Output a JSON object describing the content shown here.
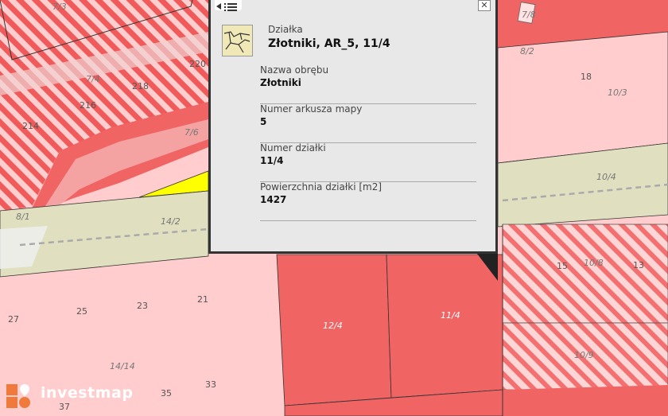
{
  "map": {
    "parcel_labels": [
      {
        "text": "7/3"
      },
      {
        "text": "7/4"
      },
      {
        "text": "218"
      },
      {
        "text": "220"
      },
      {
        "text": "216"
      },
      {
        "text": "214"
      },
      {
        "text": "7/6"
      },
      {
        "text": "8/1"
      },
      {
        "text": "14/2"
      },
      {
        "text": "7/8"
      },
      {
        "text": "8/2"
      },
      {
        "text": "18"
      },
      {
        "text": "10/3"
      },
      {
        "text": "10/4"
      },
      {
        "text": "15"
      },
      {
        "text": "10/8"
      },
      {
        "text": "13"
      },
      {
        "text": "10/9"
      },
      {
        "text": "27"
      },
      {
        "text": "25"
      },
      {
        "text": "23"
      },
      {
        "text": "21"
      },
      {
        "text": "14/14"
      },
      {
        "text": "33"
      },
      {
        "text": "35"
      },
      {
        "text": "37"
      },
      {
        "text": "12/4"
      },
      {
        "text": "11/4"
      }
    ],
    "colors": {
      "residential": "#ffcccc",
      "selected": "#ff6b6b",
      "agri": "#e0e0c0",
      "road": "#f8f8f8",
      "yellow": "#ffff00",
      "hatch": "#f06060"
    }
  },
  "popup": {
    "category": "Działka",
    "title": "Złotniki, AR_5, 11/4",
    "fields": [
      {
        "label": "Nazwa obrębu",
        "value": "Złotniki"
      },
      {
        "label": "Numer arkusza mapy",
        "value": "5"
      },
      {
        "label": "Numer działki",
        "value": "11/4"
      },
      {
        "label": "Powierzchnia działki [m2]",
        "value": "1427"
      }
    ],
    "close_glyph": "✕",
    "icons": {
      "close": "close-icon",
      "list": "list-icon",
      "thumb": "parcel-map-thumbnail-icon"
    }
  },
  "logo": {
    "text": "investmap"
  }
}
